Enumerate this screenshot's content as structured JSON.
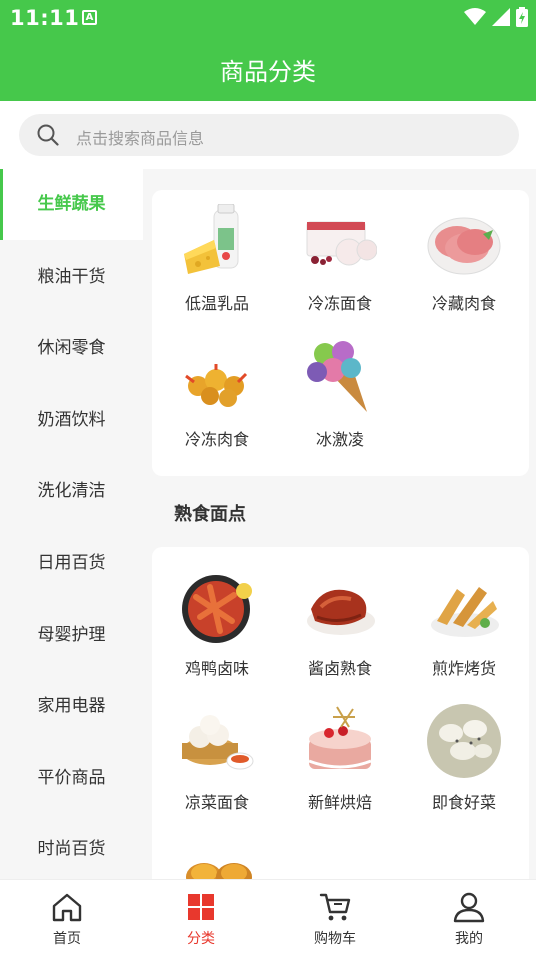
{
  "status_bar": {
    "time": "11:11",
    "notif_badge": "A"
  },
  "header": {
    "title": "商品分类"
  },
  "search": {
    "placeholder": "点击搜索商品信息"
  },
  "sidebar": {
    "items": [
      {
        "label": "生鲜蔬果",
        "active": true
      },
      {
        "label": "粮油干货"
      },
      {
        "label": "休闲零食"
      },
      {
        "label": "奶酒饮料"
      },
      {
        "label": "洗化清洁"
      },
      {
        "label": "日用百货"
      },
      {
        "label": "母婴护理"
      },
      {
        "label": "家用电器"
      },
      {
        "label": "平价商品"
      },
      {
        "label": "时尚百货"
      }
    ]
  },
  "sections": [
    {
      "items": [
        {
          "label": "低温乳品",
          "icon": "yogurt-cheese-image"
        },
        {
          "label": "冷冻面食",
          "icon": "frozen-buns-image"
        },
        {
          "label": "冷藏肉食",
          "icon": "sliced-ham-image"
        },
        {
          "label": "冷冻肉食",
          "icon": "fried-shrimp-image"
        },
        {
          "label": "冰激凌",
          "icon": "ice-cream-cone-image"
        }
      ]
    },
    {
      "title": "熟食面点",
      "items": [
        {
          "label": "鸡鸭卤味",
          "icon": "braised-chicken-feet-image"
        },
        {
          "label": "酱卤熟食",
          "icon": "braised-duck-image"
        },
        {
          "label": "煎炸烤货",
          "icon": "fried-snacks-image"
        },
        {
          "label": "凉菜面食",
          "icon": "steamed-buns-image"
        },
        {
          "label": "新鲜烘焙",
          "icon": "cake-image"
        },
        {
          "label": "即食好菜",
          "icon": "rice-cakes-image"
        },
        {
          "label": "",
          "icon": "egg-tart-image"
        }
      ]
    }
  ],
  "tab_bar": {
    "tabs": [
      {
        "label": "首页",
        "icon": "home-icon"
      },
      {
        "label": "分类",
        "icon": "category-grid-icon",
        "active": true
      },
      {
        "label": "购物车",
        "icon": "cart-icon"
      },
      {
        "label": "我的",
        "icon": "user-icon"
      }
    ]
  },
  "colors": {
    "brand_green": "#46c84b",
    "active_tab_red": "#e8382d",
    "text": "#333333"
  }
}
